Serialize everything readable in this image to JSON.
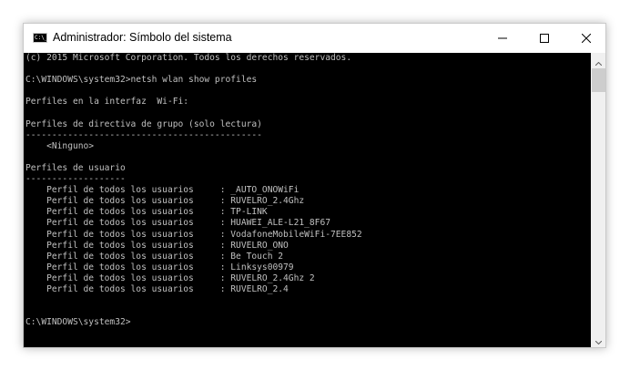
{
  "window": {
    "title": "Administrador: Símbolo del sistema",
    "icon_text": "C:\\_",
    "controls": {
      "minimize": "minimize-icon",
      "maximize": "maximize-icon",
      "close": "close-icon"
    }
  },
  "console": {
    "lines": [
      "(c) 2015 Microsoft Corporation. Todos los derechos reservados.",
      "",
      "C:\\WINDOWS\\system32>netsh wlan show profiles",
      "",
      "Perfiles en la interfaz  Wi-Fi:",
      "",
      "Perfiles de directiva de grupo (solo lectura)",
      "---------------------------------------------",
      "    <Ninguno>",
      "",
      "Perfiles de usuario",
      "-------------------",
      "    Perfil de todos los usuarios     : _AUTO_ONOWiFi",
      "    Perfil de todos los usuarios     : RUVELRO_2.4Ghz",
      "    Perfil de todos los usuarios     : TP-LINK",
      "    Perfil de todos los usuarios     : HUAWEI_ALE-L21_8F67",
      "    Perfil de todos los usuarios     : VodafoneMobileWiFi-7EE852",
      "    Perfil de todos los usuarios     : RUVELRO_ONO",
      "    Perfil de todos los usuarios     : Be Touch 2",
      "    Perfil de todos los usuarios     : Linksys00979",
      "    Perfil de todos los usuarios     : RUVELRO_2.4Ghz 2",
      "    Perfil de todos los usuarios     : RUVELRO_2.4",
      "",
      "",
      "C:\\WINDOWS\\system32>"
    ]
  },
  "scrollbar": {
    "up": "chevron-up-icon",
    "down": "chevron-down-icon"
  },
  "colors": {
    "console_bg": "#000000",
    "console_fg": "#c0c0c0",
    "titlebar_bg": "#ffffff",
    "scrollbar_bg": "#f0f0f0",
    "scroll_thumb": "#cdcdcd"
  }
}
